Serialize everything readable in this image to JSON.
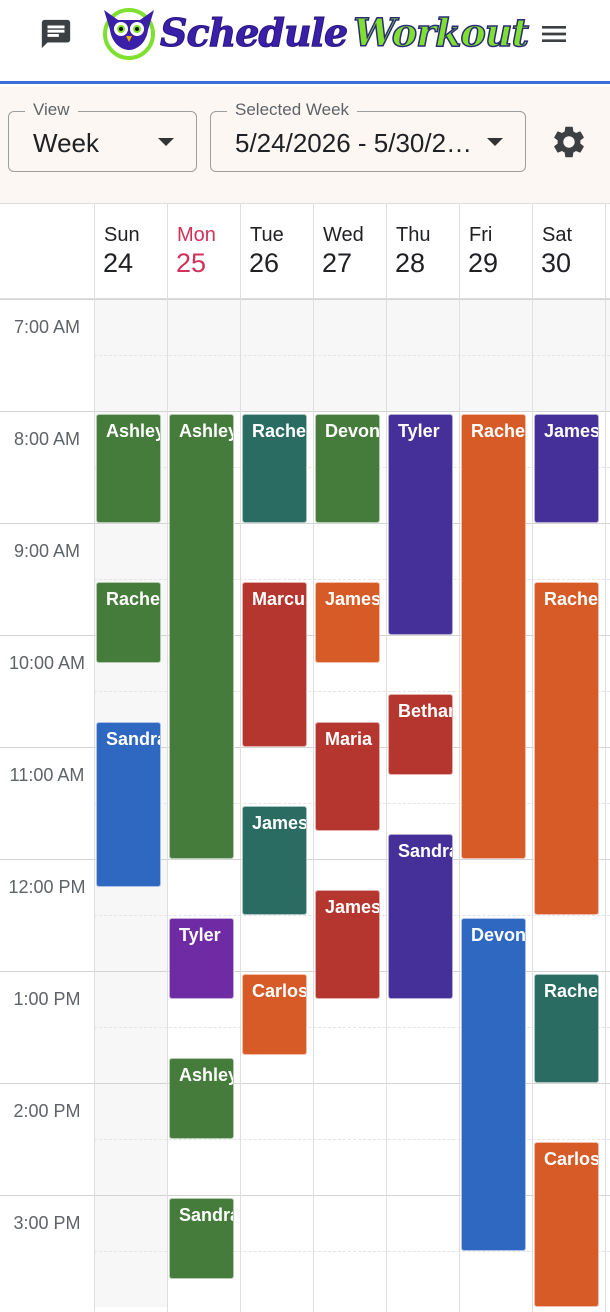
{
  "app": {
    "brand_word1": "Schedule",
    "brand_word2": "Workout",
    "chat_icon": "chat-icon",
    "menu_icon": "hamburger-menu-icon"
  },
  "controls": {
    "view_label": "View",
    "view_value": "Week",
    "week_label": "Selected Week",
    "week_value": "5/24/2026 - 5/30/2…",
    "settings_icon": "gear-icon"
  },
  "days": [
    {
      "name": "Sun",
      "num": "24",
      "today": false
    },
    {
      "name": "Mon",
      "num": "25",
      "today": true
    },
    {
      "name": "Tue",
      "num": "26",
      "today": false
    },
    {
      "name": "Wed",
      "num": "27",
      "today": false
    },
    {
      "name": "Thu",
      "num": "28",
      "today": false
    },
    {
      "name": "Fri",
      "num": "29",
      "today": false
    },
    {
      "name": "Sat",
      "num": "30",
      "today": false
    }
  ],
  "times": [
    "7:00 AM",
    "8:00 AM",
    "9:00 AM",
    "10:00 AM",
    "11:00 AM",
    "12:00 PM",
    "1:00 PM",
    "2:00 PM",
    "3:00 PM"
  ],
  "colors": {
    "green": "#457b3b",
    "teal": "#2a6b62",
    "purple": "#45309a",
    "violet": "#6f2ba3",
    "orange": "#d65b27",
    "red": "#b5362f",
    "blue": "#2f68c0",
    "today": "#d1325a",
    "accent": "#3a6fd8"
  },
  "events": [
    {
      "day": 0,
      "name": "Ashley",
      "start": "8:00",
      "end": "9:00",
      "color": "green"
    },
    {
      "day": 0,
      "name": "Rachel",
      "start": "9:30",
      "end": "10:15",
      "color": "green"
    },
    {
      "day": 0,
      "name": "Sandra",
      "start": "10:45",
      "end": "12:15",
      "color": "blue"
    },
    {
      "day": 1,
      "name": "Ashley",
      "start": "8:00",
      "end": "12:00",
      "color": "green"
    },
    {
      "day": 1,
      "name": "Tyler",
      "start": "12:30",
      "end": "13:15",
      "color": "violet"
    },
    {
      "day": 1,
      "name": "Ashley",
      "start": "13:45",
      "end": "14:30",
      "color": "green"
    },
    {
      "day": 1,
      "name": "Sandra",
      "start": "15:00",
      "end": "15:45",
      "color": "green"
    },
    {
      "day": 2,
      "name": "Rachel",
      "start": "8:00",
      "end": "9:00",
      "color": "teal"
    },
    {
      "day": 2,
      "name": "Marcus",
      "start": "9:30",
      "end": "11:00",
      "color": "red"
    },
    {
      "day": 2,
      "name": "James",
      "start": "11:30",
      "end": "12:30",
      "color": "teal"
    },
    {
      "day": 2,
      "name": "Carlos",
      "start": "13:00",
      "end": "13:45",
      "color": "orange"
    },
    {
      "day": 3,
      "name": "Devon",
      "start": "8:00",
      "end": "9:00",
      "color": "green"
    },
    {
      "day": 3,
      "name": "James",
      "start": "9:30",
      "end": "10:15",
      "color": "orange"
    },
    {
      "day": 3,
      "name": "Maria",
      "start": "10:45",
      "end": "11:45",
      "color": "red"
    },
    {
      "day": 3,
      "name": "James",
      "start": "12:15",
      "end": "13:15",
      "color": "red"
    },
    {
      "day": 4,
      "name": "Tyler",
      "start": "8:00",
      "end": "10:00",
      "color": "purple"
    },
    {
      "day": 4,
      "name": "Bethany",
      "start": "10:30",
      "end": "11:15",
      "color": "red"
    },
    {
      "day": 4,
      "name": "Sandra",
      "start": "11:45",
      "end": "13:15",
      "color": "purple"
    },
    {
      "day": 5,
      "name": "Rachel",
      "start": "8:00",
      "end": "12:00",
      "color": "orange"
    },
    {
      "day": 5,
      "name": "Devon",
      "start": "12:30",
      "end": "15:30",
      "color": "blue"
    },
    {
      "day": 6,
      "name": "James",
      "start": "8:00",
      "end": "9:00",
      "color": "purple"
    },
    {
      "day": 6,
      "name": "Rachel",
      "start": "9:30",
      "end": "12:30",
      "color": "orange"
    },
    {
      "day": 6,
      "name": "Rachel",
      "start": "13:00",
      "end": "14:00",
      "color": "teal"
    },
    {
      "day": 6,
      "name": "Carlos",
      "start": "14:30",
      "end": "16:00",
      "color": "orange"
    }
  ]
}
